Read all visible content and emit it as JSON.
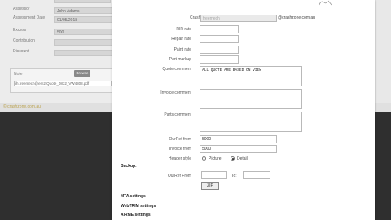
{
  "background": {
    "rows": [
      {
        "label": "Assessor",
        "value": "John Adams"
      },
      {
        "label": "Assessment Date",
        "value": "01/05/2018"
      },
      {
        "label": "Excess",
        "value": "500"
      },
      {
        "label": "Contribution",
        "value": ""
      },
      {
        "label": "Discount",
        "value": ""
      }
    ],
    "note": {
      "label": "Note",
      "button": "Browse",
      "file": "ih.freemech@em2  Quote_0832_VW4808.pdf"
    },
    "footer": "© crashzone.com.au"
  },
  "form": {
    "crashzone_email": {
      "label": "Crashzone email Address",
      "value": "freemech",
      "suffix": "@crashzone.com.au"
    },
    "rir_rate": {
      "label": "RIR rate",
      "value": ""
    },
    "repair_rate": {
      "label": "Repair rate",
      "value": ""
    },
    "paint_rate": {
      "label": "Paint rate",
      "value": ""
    },
    "part_markup": {
      "label": "Part markup",
      "value": ""
    },
    "quote_comment": {
      "label": "Quote comment",
      "value": "ALL QUOTE ARE BASED ON VIEW"
    },
    "invoice_comment": {
      "label": "Invoice comment",
      "value": ""
    },
    "parts_comment": {
      "label": "Parts comment",
      "value": ""
    },
    "ourref_from": {
      "label": "OurRef from",
      "value": "5000"
    },
    "invoice_from": {
      "label": "Invoice from",
      "value": "5000"
    },
    "header_style": {
      "label": "Header style",
      "options": [
        "Picture",
        "Detail"
      ],
      "selected": "Detail"
    },
    "backup": {
      "title": "Backup:",
      "from_label": "OurRef From",
      "from_value": "",
      "to_label": "To:",
      "to_value": "",
      "button": "ZIP"
    },
    "sections": [
      "MTA settings",
      "WebTRIM settings",
      "AIRME settings"
    ]
  },
  "colors": {
    "overlay": "#2f2f2f",
    "modal": "#ffffff",
    "footer_text": "#bba350"
  }
}
